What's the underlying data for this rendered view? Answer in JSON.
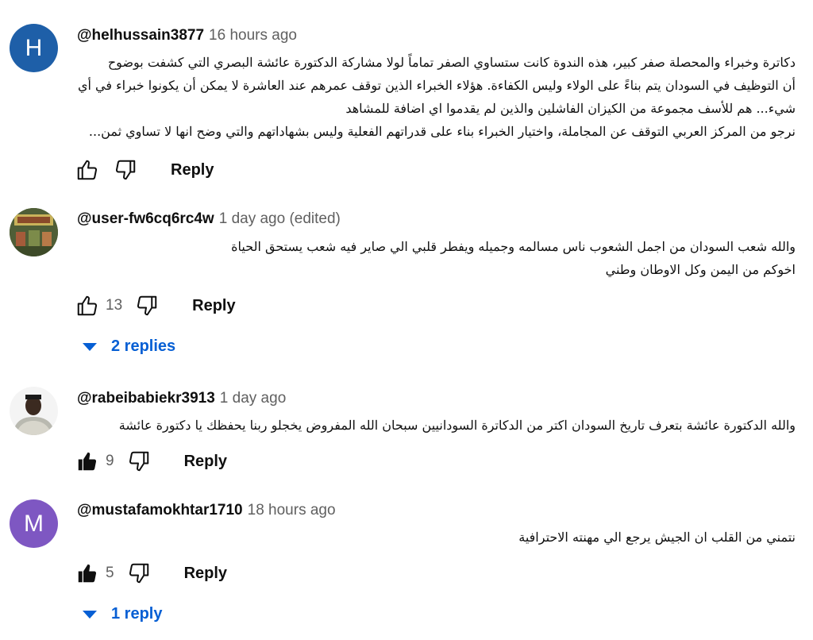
{
  "comments": [
    {
      "handle": "@helhussain3877",
      "time": "16 hours ago",
      "avatar_letter": "H",
      "avatar_color": "#1e5fa8",
      "lines": [
        "دكاترة وخبراء والمحصلة صفر كبير، هذه الندوة كانت ستساوي الصفر تماماً لولا مشاركة الدكتورة عائشة البصري التي كشفت بوضوح",
        "أن التوظيف في السودان يتم بناءً على الولاء وليس الكفاءة. هؤلاء الخبراء الذين توقف عمرهم عند العاشرة لا يمكن أن يكونوا خبراء في أي",
        "شيء... هم للأسف مجموعة من الكيزان الفاشلين والذين لم يقدموا اي اضافة للمشاهد",
        "نرجو من المركز العربي التوقف عن المجاملة، واختيار الخبراء بناء على قدراتهم الفعلية وليس بشهاداتهم والتي وضح انها لا تساوي ثمن..."
      ],
      "likes": "",
      "reply_label": "Reply"
    },
    {
      "handle": "@user-fw6cq6rc4w",
      "time": "1 day ago (edited)",
      "lines": [
        "والله شعب السودان من اجمل الشعوب ناس مسالمه وجميله ويفطر قلبي الي صاير فيه شعب يستحق الحياة",
        "اخوكم من اليمن وكل الاوطان وطني"
      ],
      "likes": "13",
      "reply_label": "Reply",
      "replies_label": "2 replies"
    },
    {
      "handle": "@rabeibabiekr3913",
      "time": "1 day ago",
      "lines": [
        "والله الدكتورة عائشة بتعرف تاريخ السودان اكتر من الدكاترة السودانيين سبحان الله المفروض يخجلو ربنا يحفظك يا دكتورة عائشة"
      ],
      "likes": "9",
      "reply_label": "Reply"
    },
    {
      "handle": "@mustafamokhtar1710",
      "time": "18 hours ago",
      "avatar_letter": "M",
      "avatar_color": "#7e57c2",
      "lines": [
        "نتمني من القلب ان الجيش يرجع الي مهنته الاحترافية"
      ],
      "likes": "5",
      "reply_label": "Reply",
      "replies_label": "1 reply"
    }
  ],
  "icons": {
    "like_outline": "thumb-up-outline-icon",
    "like_filled": "thumb-up-filled-icon",
    "dislike": "thumb-down-outline-icon",
    "expand": "caret-down-icon"
  }
}
